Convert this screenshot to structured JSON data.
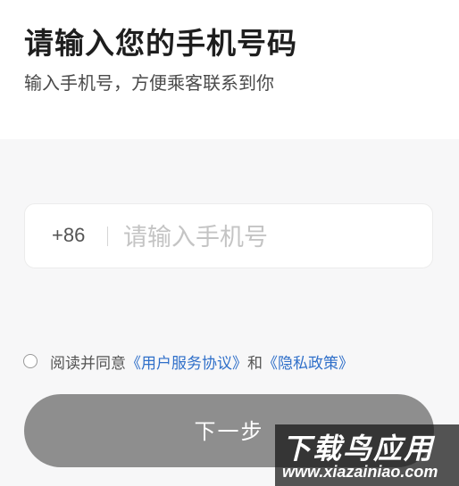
{
  "header": {
    "title": "请输入您的手机号码",
    "subtitle": "输入手机号，方便乘客联系到你"
  },
  "phone": {
    "country_code": "+86",
    "placeholder": "请输入手机号",
    "value": ""
  },
  "agreement": {
    "checked": false,
    "prefix": "阅读并同意",
    "user_agreement": "《用户服务协议》",
    "conjunction": "和",
    "privacy_policy": "《隐私政策》"
  },
  "next_button": {
    "label": "下一步"
  },
  "watermark": {
    "brand": "下载鸟应用",
    "url": "www.xiazainiao.com"
  }
}
